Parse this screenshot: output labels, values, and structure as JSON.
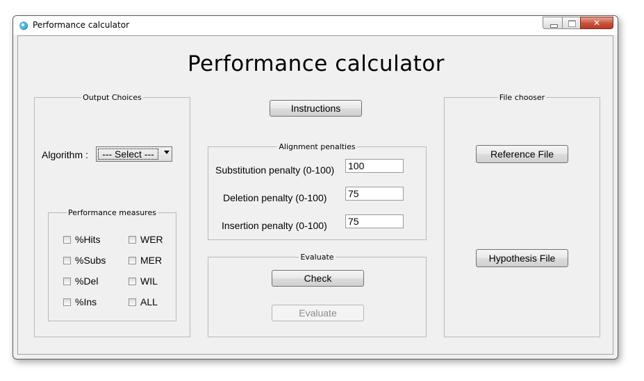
{
  "window": {
    "title": "Performance calculator",
    "close_glyph": "✕"
  },
  "heading": "Performance calculator",
  "output_choices": {
    "legend": "Output Choices",
    "algorithm_label": "Algorithm :",
    "algorithm_selected": "--- Select ---",
    "performance_measures": {
      "legend": "Performance measures",
      "items": [
        {
          "label": "%Hits",
          "checked": false
        },
        {
          "label": "WER",
          "checked": false
        },
        {
          "label": "%Subs",
          "checked": false
        },
        {
          "label": "MER",
          "checked": false
        },
        {
          "label": "%Del",
          "checked": false
        },
        {
          "label": "WIL",
          "checked": false
        },
        {
          "label": "%Ins",
          "checked": false
        },
        {
          "label": "ALL",
          "checked": false
        }
      ]
    }
  },
  "instructions_button": "Instructions",
  "alignment": {
    "legend": "Alignment penalties",
    "substitution_label": "Substitution penalty (0-100)",
    "substitution_value": "100",
    "deletion_label": "Deletion penalty (0-100)",
    "deletion_value": "75",
    "insertion_label": "Insertion penalty (0-100)",
    "insertion_value": "75"
  },
  "evaluate": {
    "legend": "Evaluate",
    "check_button": "Check",
    "evaluate_button": "Evaluate",
    "evaluate_enabled": false
  },
  "file_chooser": {
    "legend": "File chooser",
    "reference_button": "Reference File",
    "hypothesis_button": "Hypothesis File"
  }
}
